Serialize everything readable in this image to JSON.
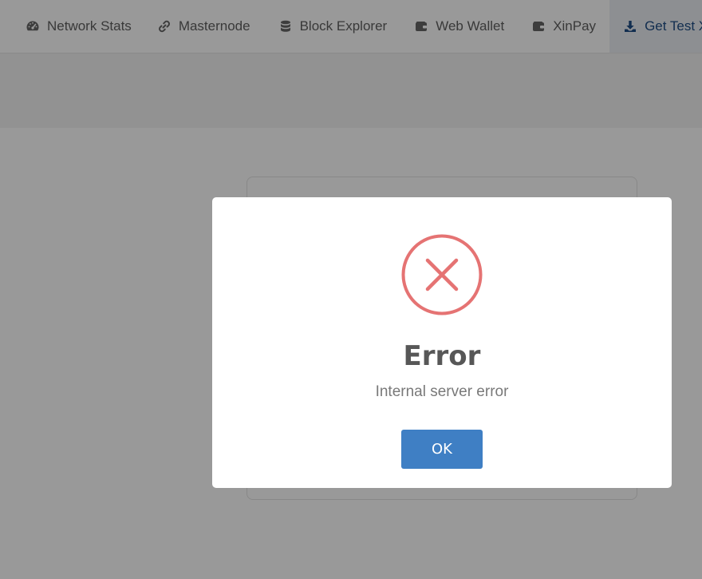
{
  "nav": {
    "items": [
      {
        "label": "Network Stats",
        "icon": "dashboard-icon"
      },
      {
        "label": "Masternode",
        "icon": "link-icon"
      },
      {
        "label": "Block Explorer",
        "icon": "database-icon"
      },
      {
        "label": "Web Wallet",
        "icon": "wallet-icon"
      },
      {
        "label": "XinPay",
        "icon": "wallet-icon"
      },
      {
        "label": "Get Test XDC",
        "icon": "download-icon",
        "active": true
      }
    ]
  },
  "modal": {
    "icon": "error-x-icon",
    "title": "Error",
    "text": "Internal server error",
    "ok_label": "OK"
  },
  "colors": {
    "active_nav_text": "#1f4e85",
    "error_icon": "#e57373",
    "ok_button": "#3f7fc4"
  }
}
